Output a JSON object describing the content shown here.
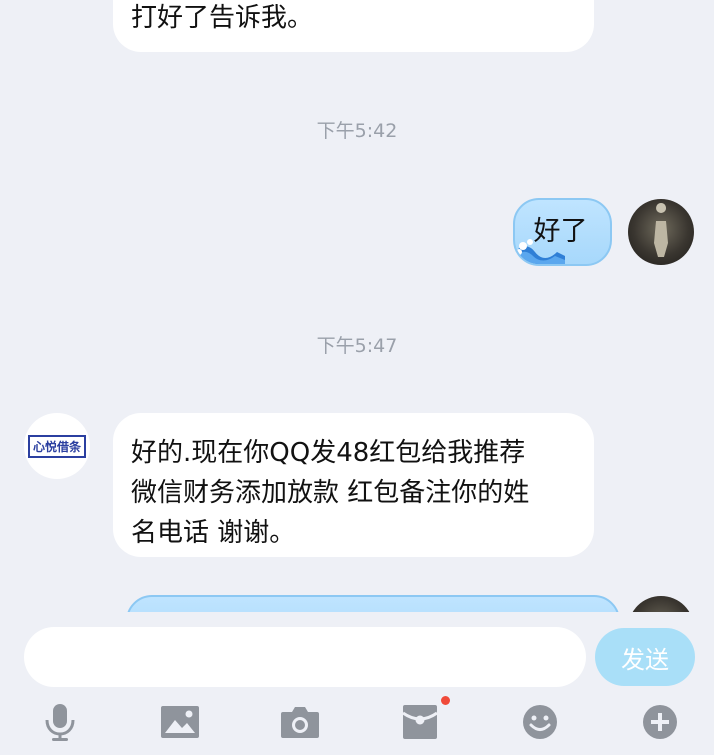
{
  "messages": {
    "first_incoming_tail": "打好了告诉我。",
    "time_1": "下午5:42",
    "outgoing_1": "好了",
    "time_2": "下午5:47",
    "incoming_2": {
      "line1": "好的.现在你QQ发48红包给我推荐",
      "line2": "微信财务添加放款 红包备注你的姓",
      "line3": "名电话 谢谢。"
    },
    "contact_avatar_logo": "心悦借条"
  },
  "composer": {
    "input_value": "",
    "send_label": "发送"
  },
  "toolbar": {
    "icons": [
      "microphone-icon",
      "image-icon",
      "camera-icon",
      "red-packet-icon",
      "emoji-icon",
      "plus-icon"
    ]
  },
  "colors": {
    "background": "#eef0f6",
    "outgoing_bubble": "#a7d8fb",
    "send_button": "#a9dff8",
    "icon_gray": "#8f949c",
    "badge_red": "#f04a3a"
  }
}
